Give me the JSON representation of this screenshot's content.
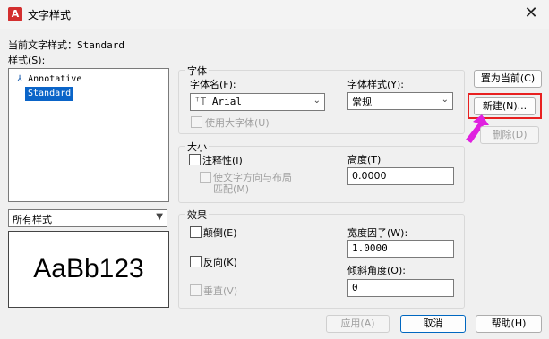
{
  "window": {
    "title": "文字样式",
    "app_icon_letter": "A"
  },
  "current_style": {
    "label": "当前文字样式：",
    "value": "Standard"
  },
  "styles_list": {
    "label": "样式(S):",
    "items": [
      "Annotative",
      "Standard"
    ],
    "selected": "Standard"
  },
  "filter": {
    "value": "所有样式"
  },
  "preview": {
    "text": "AaBb123"
  },
  "font": {
    "group_label": "字体",
    "name_label": "字体名(F):",
    "name_value": "Arial",
    "style_label": "字体样式(Y):",
    "style_value": "常规",
    "bigfont_label": "使用大字体(U)"
  },
  "size": {
    "group_label": "大小",
    "annotative_label": "注释性(I)",
    "match_label_1": "使文字方向与布局",
    "match_label_2": "匹配(M)",
    "height_label": "高度(T)",
    "height_value": "0.0000"
  },
  "effects": {
    "group_label": "效果",
    "upside_down": "颠倒(E)",
    "backwards": "反向(K)",
    "vertical": "垂直(V)",
    "width_label": "宽度因子(W):",
    "width_value": "1.0000",
    "oblique_label": "倾斜角度(O):",
    "oblique_value": "0"
  },
  "buttons": {
    "set_current": "置为当前(C)",
    "new": "新建(N)...",
    "delete": "删除(D)",
    "apply": "应用(A)",
    "cancel": "取消",
    "help": "帮助(H)"
  },
  "colors": {
    "selection": "#0a64c8",
    "highlight_box": "#e82020",
    "arrow": "#e020e0"
  }
}
